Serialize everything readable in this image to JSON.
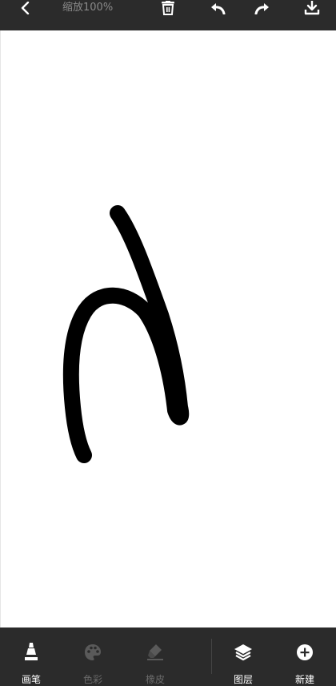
{
  "topbar": {
    "zoom_label": "缩放100%",
    "icons": [
      "back-chevron-icon",
      "trash-icon",
      "undo-icon",
      "redo-icon",
      "download-icon"
    ]
  },
  "toolbar": {
    "items": [
      {
        "label": "画笔",
        "icon": "pen-icon",
        "enabled": true
      },
      {
        "label": "色彩",
        "icon": "palette-icon",
        "enabled": false
      },
      {
        "label": "橡皮",
        "icon": "eraser-icon",
        "enabled": false
      },
      {
        "label": "图层",
        "icon": "layers-icon",
        "enabled": true
      },
      {
        "label": "新建",
        "icon": "plus-circle-icon",
        "enabled": true
      }
    ]
  },
  "colors": {
    "bar_background": "#2b2b2b",
    "active_text": "#ffffff",
    "disabled_text": "#6a6a6a",
    "stroke": "#000000"
  }
}
